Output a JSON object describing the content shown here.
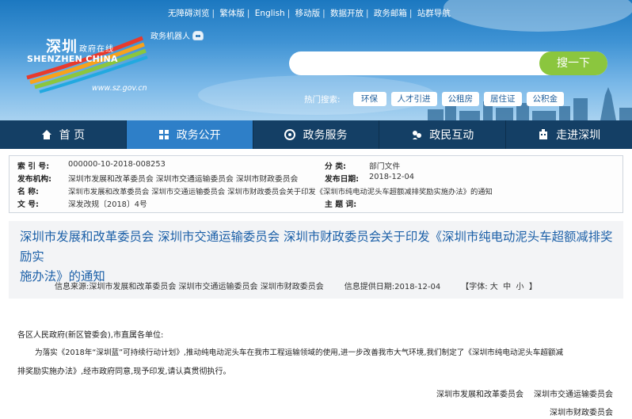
{
  "top_links": [
    "无障碍浏览",
    "繁体版",
    "English",
    "移动版",
    "数据开放",
    "政务邮箱",
    "站群导航"
  ],
  "robot_label": "政务机器人",
  "logo": {
    "cn": "深圳",
    "cn_small": "政府在线",
    "en": "SHENZHEN CHINA",
    "url": "www.sz.gov.cn"
  },
  "search": {
    "placeholder": "",
    "button": "搜一下"
  },
  "hot": {
    "label": "热门搜索:",
    "tags": [
      "环保",
      "人才引进",
      "公租房",
      "居住证",
      "公积金"
    ]
  },
  "nav": [
    {
      "label": "首 页",
      "icon": "home-icon"
    },
    {
      "label": "政务公开",
      "icon": "grid-icon"
    },
    {
      "label": "政务服务",
      "icon": "service-icon"
    },
    {
      "label": "政民互动",
      "icon": "chat-icon"
    },
    {
      "label": "走进深圳",
      "icon": "building-icon"
    }
  ],
  "info": {
    "index_k": "索 引 号:",
    "index_v": "000000-10-2018-008253",
    "category_k": "分    类:",
    "category_v": "部门文件",
    "issuer_k": "发布机构:",
    "issuer_v": "深圳市发展和改革委员会 深圳市交通运输委员会 深圳市财政委员会",
    "date_k": "发布日期:",
    "date_v": "2018-12-04",
    "name_k": "名    称:",
    "name_v": "深圳市发展和改革委员会 深圳市交通运输委员会 深圳市财政委员会关于印发《深圳市纯电动泥头车超额减排奖励实施办法》的通知",
    "docno_k": "文    号:",
    "docno_v": "深发改规〔2018〕4号",
    "subject_k": "主 题 词:",
    "subject_v": ""
  },
  "title_line1": "深圳市发展和改革委员会 深圳市交通运输委员会 深圳市财政委员会关于印发《深圳市纯电动泥头车超额减排奖励实",
  "title_line2": "施办法》的通知",
  "meta": {
    "source": "信息来源:深圳市发展和改革委员会 深圳市交通运输委员会 深圳市财政委员会",
    "provided": "信息提供日期:2018-12-04",
    "font_label": "【字体:",
    "font_large": "大",
    "font_medium": "中",
    "font_small": "小",
    "font_close": "】"
  },
  "body": {
    "greeting": "各区人民政府(新区管委会),市直属各单位:",
    "para_line1": "为落实《2018年“深圳蓝”可持续行动计划》,推动纯电动泥头车在我市工程运输领域的使用,进一步改善我市大气环境,我们制定了《深圳市纯电动泥头车超额减",
    "para_line2": "排奖励实施办法》,经市政府同意,现予印发,请认真贯彻执行。",
    "sign1": "深圳市发展和改革委员会",
    "sign2": "深圳市交通运输委员会",
    "sign3": "深圳市财政委员会"
  }
}
